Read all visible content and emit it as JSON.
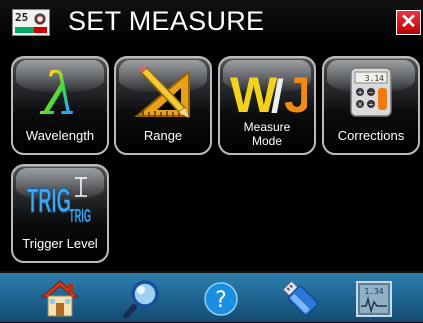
{
  "window": {
    "title": "SET MEASURE",
    "app_icon": {
      "name": "meter-app-icon",
      "number": "25"
    },
    "close_icon": "close-icon",
    "close_glyph": "✕"
  },
  "tiles": [
    {
      "label": "Wavelength",
      "icon": "lambda-icon",
      "glyph": "λ"
    },
    {
      "label": "Range",
      "icon": "ruler-pencil-icon"
    },
    {
      "label": "Measure\nMode",
      "label_line1": "Measure",
      "label_line2": "Mode",
      "icon": "watt-joule-icon",
      "glyph_w": "W",
      "glyph_slash": "/",
      "glyph_j": "J"
    },
    {
      "label": "Corrections",
      "icon": "calculator-icon",
      "display": "3.14"
    },
    {
      "label": "Trigger Level",
      "icon": "trigger-icon",
      "glyph": "TRIG",
      "glyph_small": "TRIG"
    }
  ],
  "navbar": [
    {
      "name": "home-icon"
    },
    {
      "name": "search-icon"
    },
    {
      "name": "help-icon",
      "glyph": "?"
    },
    {
      "name": "usb-icon"
    },
    {
      "name": "monitor-icon",
      "display": "1.34"
    }
  ],
  "colors": {
    "nav_bar": "#1f6592",
    "close_red": "#d01020",
    "tile_border": "#bbbbbb"
  }
}
